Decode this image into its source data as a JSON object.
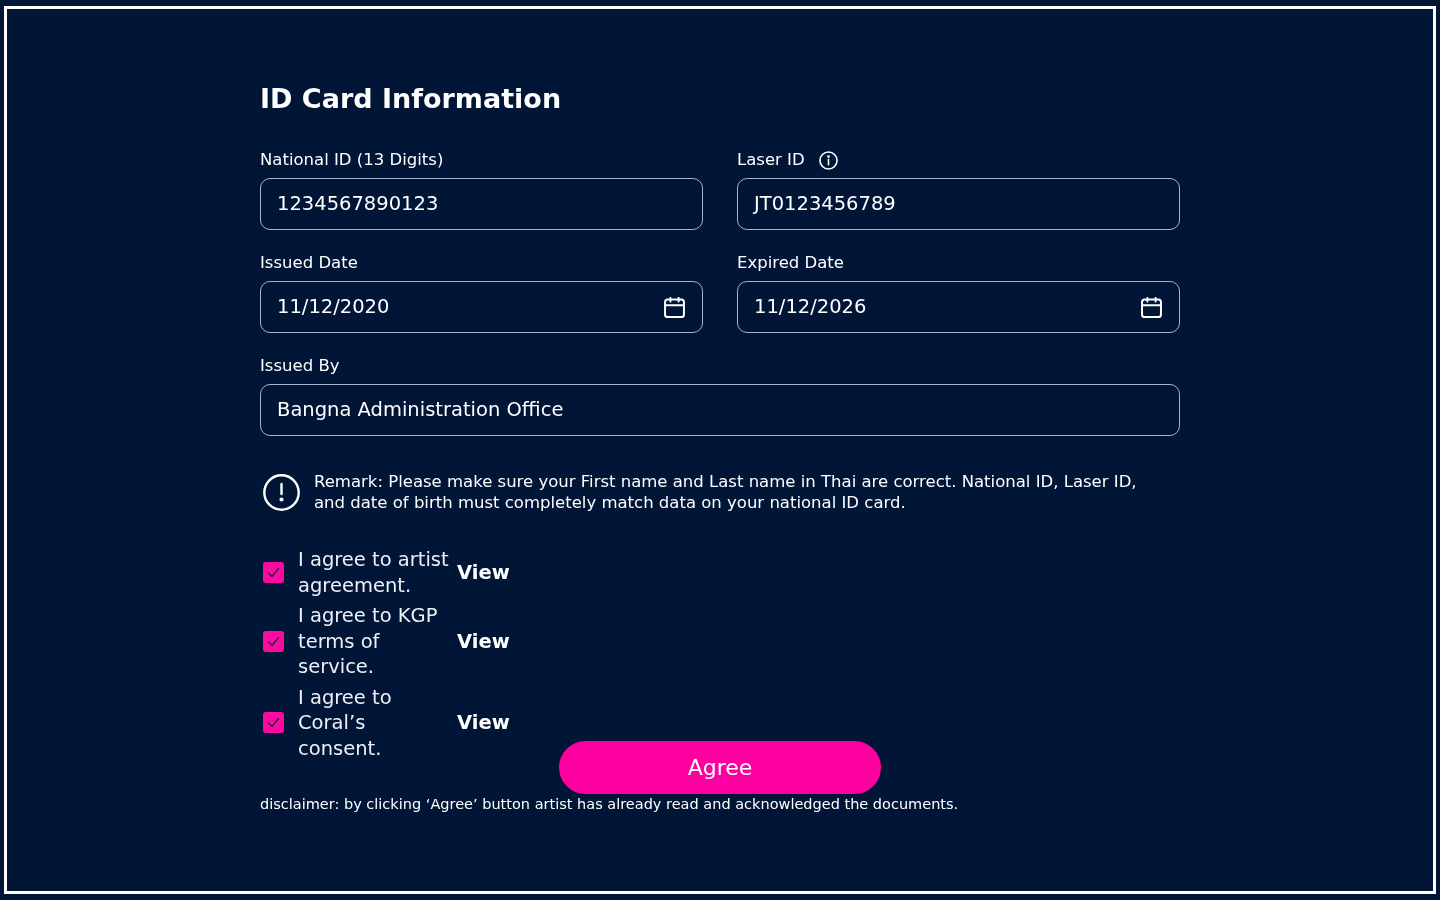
{
  "title": "ID Card Information",
  "form_rows": [
    {
      "fields": [
        {
          "label": "National ID (13 Digits)",
          "info": false,
          "kind": "text",
          "value": "1234567890123"
        },
        {
          "label": "Laser ID",
          "info": true,
          "kind": "text",
          "value": "JT0123456789"
        }
      ]
    },
    {
      "fields": [
        {
          "label": "Issued Date",
          "info": false,
          "kind": "date",
          "value": "11/12/2020"
        },
        {
          "label": "Expired Date",
          "info": false,
          "kind": "date",
          "value": "11/12/2026"
        }
      ]
    },
    {
      "fields": [
        {
          "label": "Issued By",
          "info": false,
          "kind": "text",
          "value": "Bangna Administration Office"
        }
      ]
    }
  ],
  "remark": "Remark: Please make sure your First name and Last name in Thai are correct. National ID, Laser ID, and date of birth must completely match data on your national ID card.",
  "agreements": [
    {
      "text": "I agree to artist agreement.",
      "checked": true,
      "link": "View"
    },
    {
      "text": "I agree to KGP terms of service.",
      "checked": true,
      "link": "View"
    },
    {
      "text": "I agree to Coral’s consent.",
      "checked": true,
      "link": "View"
    }
  ],
  "agree_button": "Agree",
  "disclaimer": "disclaimer: by clicking ‘Agree’ button artist has already read and acknowledged the documents."
}
